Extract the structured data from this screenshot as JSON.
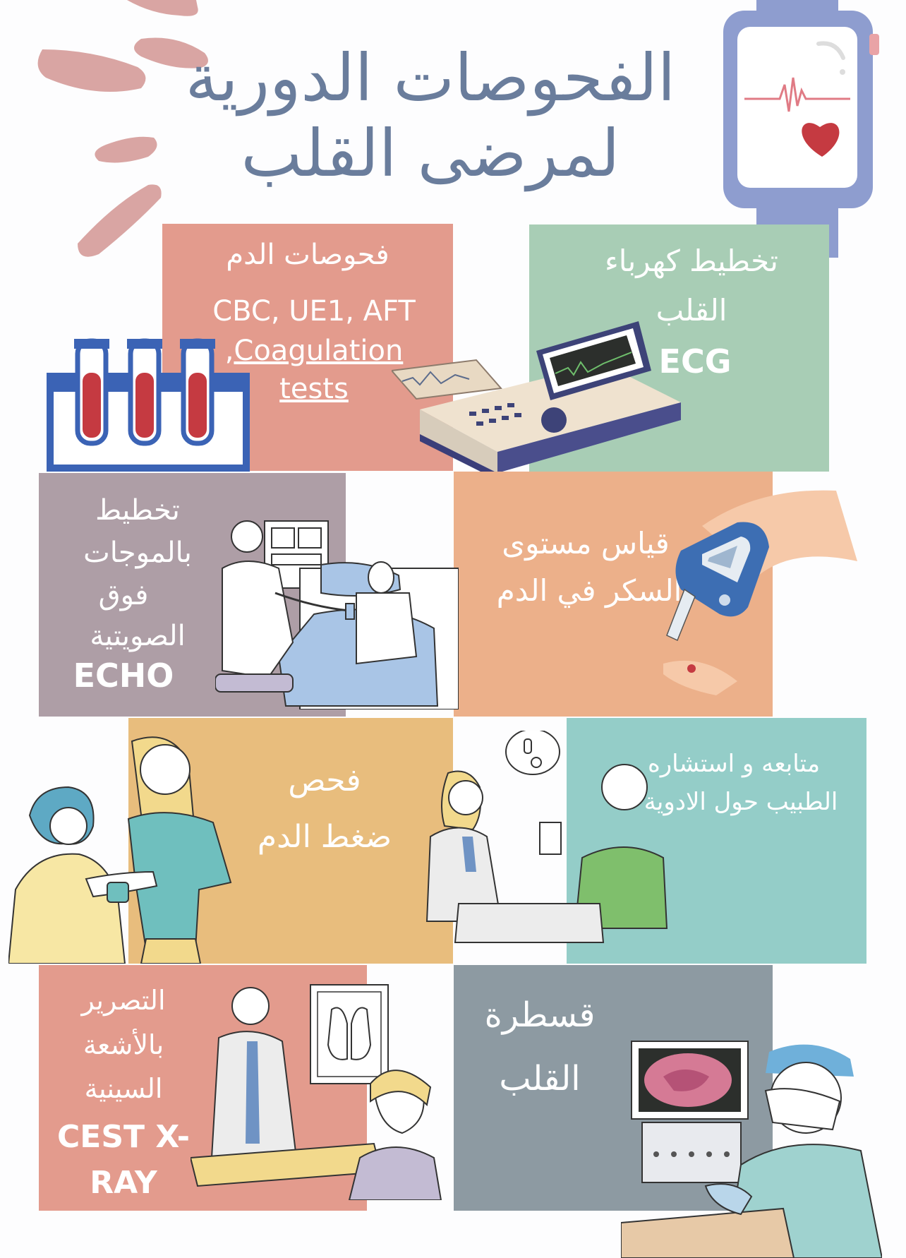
{
  "title": {
    "line1": "الفحوصات الدورية",
    "line2": "لمرضى القلب"
  },
  "cards": {
    "blood_tests": {
      "title": "فحوصات الدم",
      "line1": "CBC, UE1, AFT",
      "line2_prefix": ",",
      "line2_link": "Coagulation",
      "line3_link": "tests",
      "color": "#e39b8d"
    },
    "ecg": {
      "title_line1": "تخطيط كهرباء",
      "title_line2": "القلب",
      "abbr": "ECG",
      "color": "#a8cdb5"
    },
    "echo": {
      "line1": "تخطيط",
      "line2": "بالموجات",
      "line3": "فوق",
      "line4": "الصويتية",
      "abbr": "ECHO",
      "color": "#ae9ea6"
    },
    "sugar": {
      "line1": "قياس مستوى",
      "line2": "السكر في الدم",
      "color": "#ecb08a"
    },
    "bp": {
      "line1": "فحص",
      "line2": "ضغط الدم",
      "color": "#e8bd7d"
    },
    "followup": {
      "line1": "متابعه و استشاره",
      "line2": "الطبيب حول الادوية",
      "color": "#94cdc8"
    },
    "xray": {
      "line1": "التصرير",
      "line2": "بالأشعة",
      "line3": "السينية",
      "abbr1": "CEST X-",
      "abbr2": "RAY",
      "color": "#e39b8d"
    },
    "cath": {
      "line1": "قسطرة",
      "line2": "القلب",
      "color": "#8d9aa2"
    }
  }
}
